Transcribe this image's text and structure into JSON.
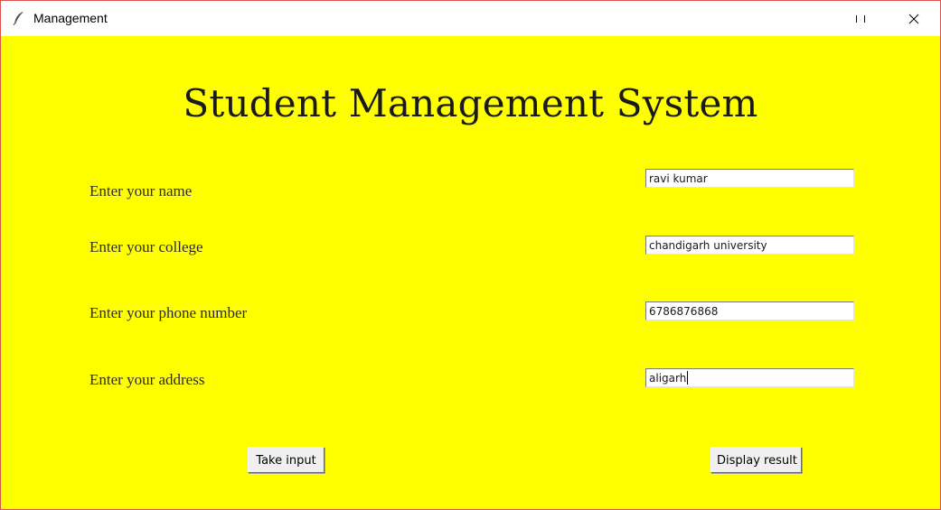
{
  "window": {
    "title": "Management",
    "app_icon": "feather-icon",
    "controls": [
      "maximize-icon",
      "close-icon"
    ]
  },
  "heading": "Student Management System",
  "form": {
    "fields": [
      {
        "label": "Enter your name",
        "value": "ravi kumar"
      },
      {
        "label": "Enter your college",
        "value": "chandigarh university"
      },
      {
        "label": "Enter your phone number",
        "value": "6786876868"
      },
      {
        "label": "Enter your address",
        "value": "aligarh"
      }
    ]
  },
  "buttons": {
    "take_input": "Take input",
    "display_result": "Display result"
  },
  "colors": {
    "background": "#ffff00",
    "titlebar": "#ffffff",
    "border": "#d9534f"
  }
}
